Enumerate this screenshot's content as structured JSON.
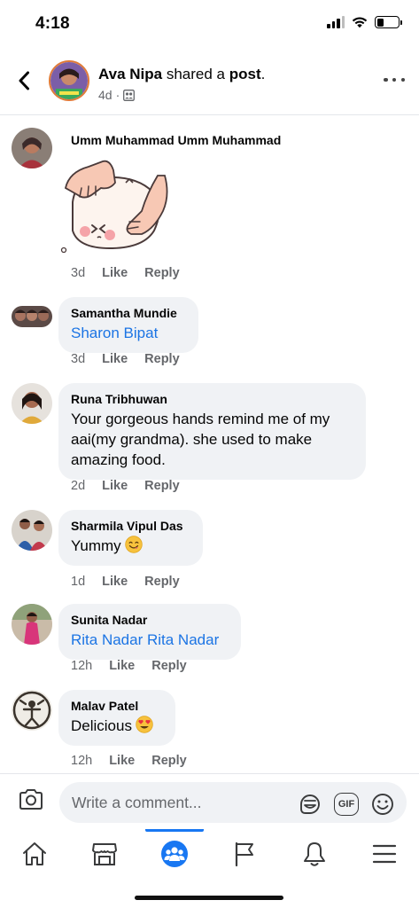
{
  "status_bar": {
    "time": "4:18"
  },
  "header": {
    "author": "Ava Nipa",
    "action": " shared a ",
    "object": "post",
    "period": ".",
    "age": "4d",
    "separator": "·"
  },
  "comments": [
    {
      "name": "Umm Muhammad Umm Muhammad",
      "time": "3d",
      "like": "Like",
      "reply": "Reply",
      "attachment": "sticker-kneading-dough"
    },
    {
      "name": "Samantha Mundie",
      "text": "Sharon Bipat",
      "text_is_link": true,
      "time": "3d",
      "like": "Like",
      "reply": "Reply"
    },
    {
      "name": "Runa Tribhuwan",
      "text": "Your gorgeous hands remind me of my aai(my grandma). she used to make amazing food.",
      "time": "2d",
      "like": "Like",
      "reply": "Reply"
    },
    {
      "name": "Sharmila Vipul Das",
      "text": "Yummy",
      "emoji": "yum-face-emoji",
      "time": "1d",
      "like": "Like",
      "reply": "Reply"
    },
    {
      "name": "Sunita Nadar",
      "text": "Rita Nadar Rita Nadar",
      "text_is_link": true,
      "time": "12h",
      "like": "Like",
      "reply": "Reply"
    },
    {
      "name": "Malav Patel",
      "text": "Delicious",
      "emoji": "heart-eyes-emoji",
      "time": "12h",
      "like": "Like",
      "reply": "Reply"
    }
  ],
  "composer": {
    "placeholder": "Write a comment...",
    "icons": [
      "camera-icon",
      "sticker-icon",
      "gif-icon",
      "emoji-icon"
    ],
    "gif_label": "GIF"
  },
  "bottom_nav": {
    "items": [
      "home-icon",
      "marketplace-icon",
      "groups-icon",
      "pages-flag-icon",
      "notifications-icon",
      "menu-icon"
    ],
    "active": "groups-icon"
  },
  "colors": {
    "link": "#1b74e4",
    "accent": "#1877f2",
    "bubble": "#f0f2f5",
    "meta": "#65676b"
  }
}
